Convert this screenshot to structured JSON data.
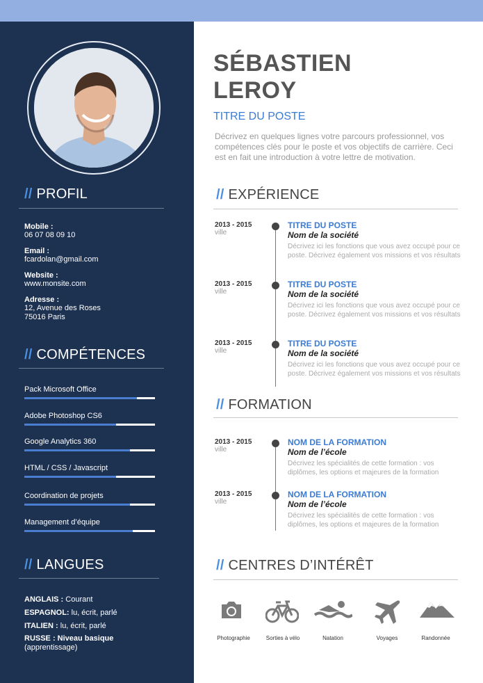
{
  "header": {
    "name_line1": "SÉBASTIEN",
    "name_line2": "LEROY",
    "job_title": "TITRE DU POSTE",
    "intro": "Décrivez en quelques lignes votre parcours professionnel, vos compétences clés pour le poste et vos objectifs de carrière. Ceci est en fait une introduction à votre lettre de motivation."
  },
  "sidebar": {
    "profile": {
      "slash": "//",
      "title": "PROFIL",
      "mobile_label": "Mobile :",
      "mobile_value": "06 07 08 09 10",
      "email_label": "Email :",
      "email_value": "fcardolan@gmail.com",
      "website_label": "Website :",
      "website_value": "www.monsite.com",
      "address_label": "Adresse :",
      "address_line1": "12, Avenue des Roses",
      "address_line2": "75016 Paris"
    },
    "skills": {
      "slash": "//",
      "title": "COMPÉTENCES",
      "items": [
        {
          "name": "Pack Microsoft Office",
          "level": 0.86
        },
        {
          "name": "Adobe Photoshop CS6",
          "level": 0.7
        },
        {
          "name": "Google Analytics 360",
          "level": 0.81
        },
        {
          "name": "HTML / CSS / Javascript",
          "level": 0.7
        },
        {
          "name": "Coordination de projets",
          "level": 0.81
        },
        {
          "name": "Management d’équipe",
          "level": 0.83
        }
      ]
    },
    "languages": {
      "slash": "//",
      "title": "LANGUES",
      "items": [
        {
          "lang": "ANGLAIS :",
          "level": " Courant"
        },
        {
          "lang": "ESPAGNOL:",
          "level": " lu, écrit, parlé"
        },
        {
          "lang": "ITALIEN :",
          "level": " lu, écrit, parlé"
        },
        {
          "lang": "RUSSE : Niveau basique",
          "level": "(apprentissage)"
        }
      ]
    }
  },
  "experience": {
    "slash": "//",
    "title": "EXPÉRIENCE",
    "items": [
      {
        "dates": "2013 - 2015",
        "city": "ville",
        "title": "TITRE DU POSTE",
        "company": "Nom de la société",
        "desc": "Décrivez ici les fonctions que vous avez occupé pour ce poste. Décrivez également vos missions et vos résultats"
      },
      {
        "dates": "2013 - 2015",
        "city": "ville",
        "title": "TITRE DU POSTE",
        "company": "Nom de la société",
        "desc": "Décrivez ici les fonctions que vous avez occupé pour ce poste. Décrivez également vos missions et vos résultats"
      },
      {
        "dates": "2013 - 2015",
        "city": "ville",
        "title": "TITRE DU POSTE",
        "company": "Nom de la société",
        "desc": "Décrivez ici les fonctions que vous avez occupé pour ce poste. Décrivez également vos missions et vos résultats"
      }
    ]
  },
  "education": {
    "slash": "//",
    "title": "FORMATION",
    "items": [
      {
        "dates": "2013 - 2015",
        "city": "ville",
        "title": "NOM DE LA FORMATION",
        "school": "Nom de l’école",
        "desc": "Décrivez les spécialités de cette formation : vos diplômes, les options et majeures de la formation"
      },
      {
        "dates": "2013 - 2015",
        "city": "ville",
        "title": "NOM DE LA FORMATION",
        "school": "Nom de l’école",
        "desc": "Décrivez les spécialités de cette formation : vos diplômes, les options et majeures de la formation"
      }
    ]
  },
  "interests": {
    "slash": "//",
    "title": "CENTRES D’INTÉRÊT",
    "items": [
      {
        "label": "Photographie",
        "icon": "camera-icon"
      },
      {
        "label": "Sorties à vélo",
        "icon": "bicycle-icon"
      },
      {
        "label": "Natation",
        "icon": "swimmer-icon"
      },
      {
        "label": "Voyages",
        "icon": "airplane-icon"
      },
      {
        "label": "Randonnée",
        "icon": "mountain-icon"
      }
    ]
  },
  "colors": {
    "sidebar": "#1d3150",
    "accent": "#3b7bd4",
    "top_strip": "#93aee0"
  }
}
